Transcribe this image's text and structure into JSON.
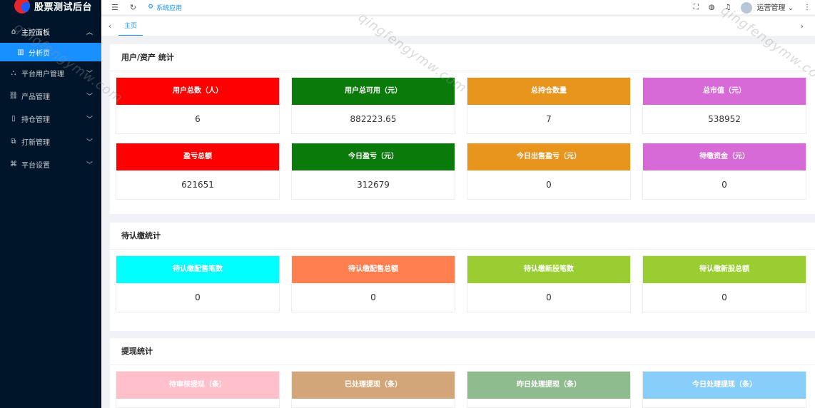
{
  "app": {
    "title": "股票测试后台"
  },
  "header": {
    "active_tab": "系统应用",
    "user": "运营管理"
  },
  "tabsbar": {
    "home": "主页"
  },
  "sidebar": {
    "items": [
      {
        "label": "主控面板",
        "icon": "home-icon",
        "expanded": true
      },
      {
        "label": "分析页",
        "icon": "chart-icon"
      },
      {
        "label": "平台用户管理",
        "icon": "users-icon"
      },
      {
        "label": "产品管理",
        "icon": "link-icon"
      },
      {
        "label": "持仓管理",
        "icon": "file-icon"
      },
      {
        "label": "打新管理",
        "icon": "copy-icon"
      },
      {
        "label": "平台设置",
        "icon": "sitemap-icon"
      }
    ]
  },
  "sections": [
    {
      "title": "用户/资产 统计",
      "cards": [
        {
          "label": "用户总数（人）",
          "value": "6",
          "color": "#ff0000"
        },
        {
          "label": "用户总可用（元）",
          "value": "882223.65",
          "color": "#0a7a0a"
        },
        {
          "label": "总持仓数量",
          "value": "7",
          "color": "#e8951d"
        },
        {
          "label": "总市值（元）",
          "value": "538952",
          "color": "#d76ad6"
        },
        {
          "label": "盈亏总额",
          "value": "621651",
          "color": "#ff0000"
        },
        {
          "label": "今日盈亏（元）",
          "value": "312679",
          "color": "#0a7a0a"
        },
        {
          "label": "今日出售盈亏（元）",
          "value": "0",
          "color": "#e8951d"
        },
        {
          "label": "待缴资金（元）",
          "value": "0",
          "color": "#d76ad6"
        }
      ]
    },
    {
      "title": "待认缴统计",
      "cards": [
        {
          "label": "待认缴配售笔数",
          "value": "0",
          "color": "#00ffff"
        },
        {
          "label": "待认缴配售总额",
          "value": "0",
          "color": "#ff7f50"
        },
        {
          "label": "待认缴新股笔数",
          "value": "0",
          "color": "#9acd32"
        },
        {
          "label": "待认缴新股总额",
          "value": "0",
          "color": "#9acd32"
        }
      ]
    },
    {
      "title": "提现统计",
      "cards": [
        {
          "label": "待审核提现（条）",
          "value": "",
          "color": "#ffc0cb"
        },
        {
          "label": "已处理提现（条）",
          "value": "",
          "color": "#d2a679"
        },
        {
          "label": "昨日处理提现（条）",
          "value": "",
          "color": "#8fbc8f"
        },
        {
          "label": "今日处理提现（条）",
          "value": "",
          "color": "#87cefa"
        }
      ]
    }
  ],
  "watermark": "qingfengymw.com"
}
